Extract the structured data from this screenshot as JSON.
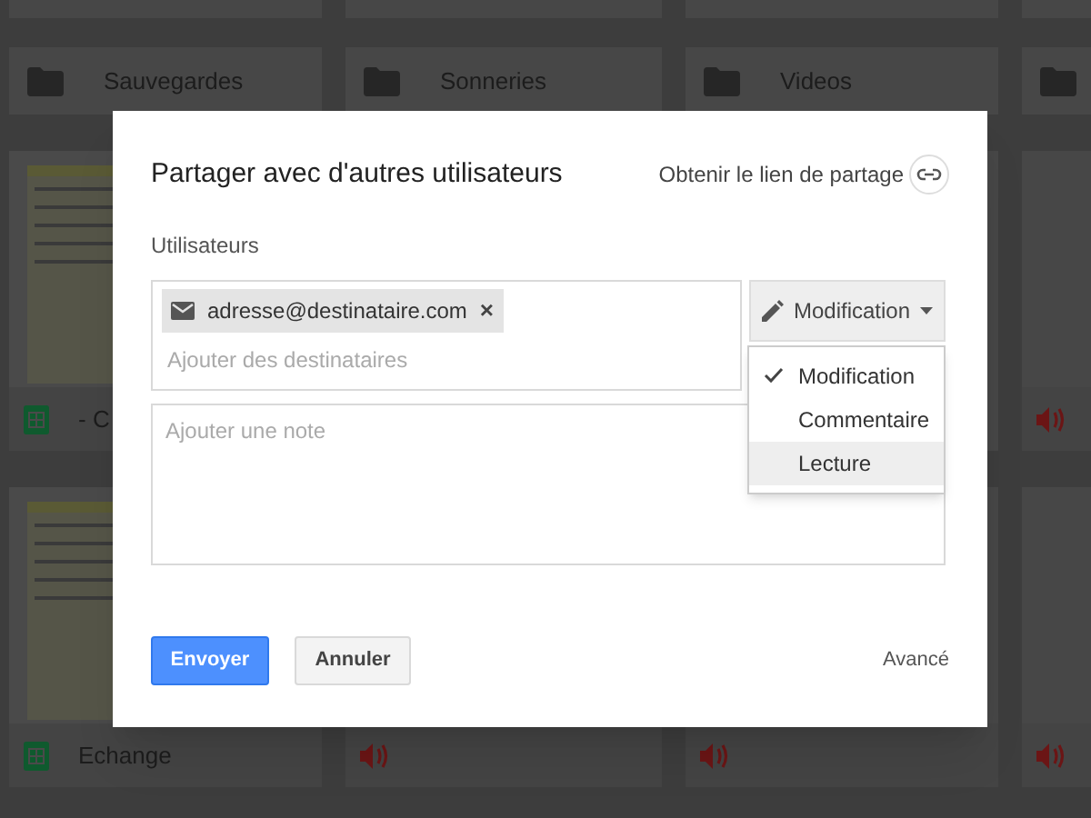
{
  "background": {
    "folders": [
      {
        "name": "Sauvegardes"
      },
      {
        "name": "Sonneries"
      },
      {
        "name": "Videos"
      }
    ],
    "file_rows": [
      [
        {
          "kind": "sheet",
          "name": "- C"
        },
        {
          "kind": "audio"
        }
      ],
      [
        {
          "kind": "sheet",
          "name": "Echange"
        },
        {
          "kind": "audio"
        },
        {
          "kind": "audio"
        },
        {
          "kind": "audio"
        }
      ]
    ]
  },
  "dialog": {
    "title": "Partager avec d'autres utilisateurs",
    "share_link": "Obtenir le lien de partage",
    "users_label": "Utilisateurs",
    "recipients": [
      {
        "email": "adresse@destinataire.com",
        "remove": "×"
      }
    ],
    "recipient_placeholder": "Ajouter des destinataires",
    "permission_button": "Modification",
    "permission_menu": [
      {
        "label": "Modification",
        "selected": true,
        "hovered": false
      },
      {
        "label": "Commentaire",
        "selected": false,
        "hovered": false
      },
      {
        "label": "Lecture",
        "selected": false,
        "hovered": true
      }
    ],
    "note_placeholder": "Ajouter une note",
    "send_button": "Envoyer",
    "cancel_button": "Annuler",
    "advanced_link": "Avancé"
  }
}
